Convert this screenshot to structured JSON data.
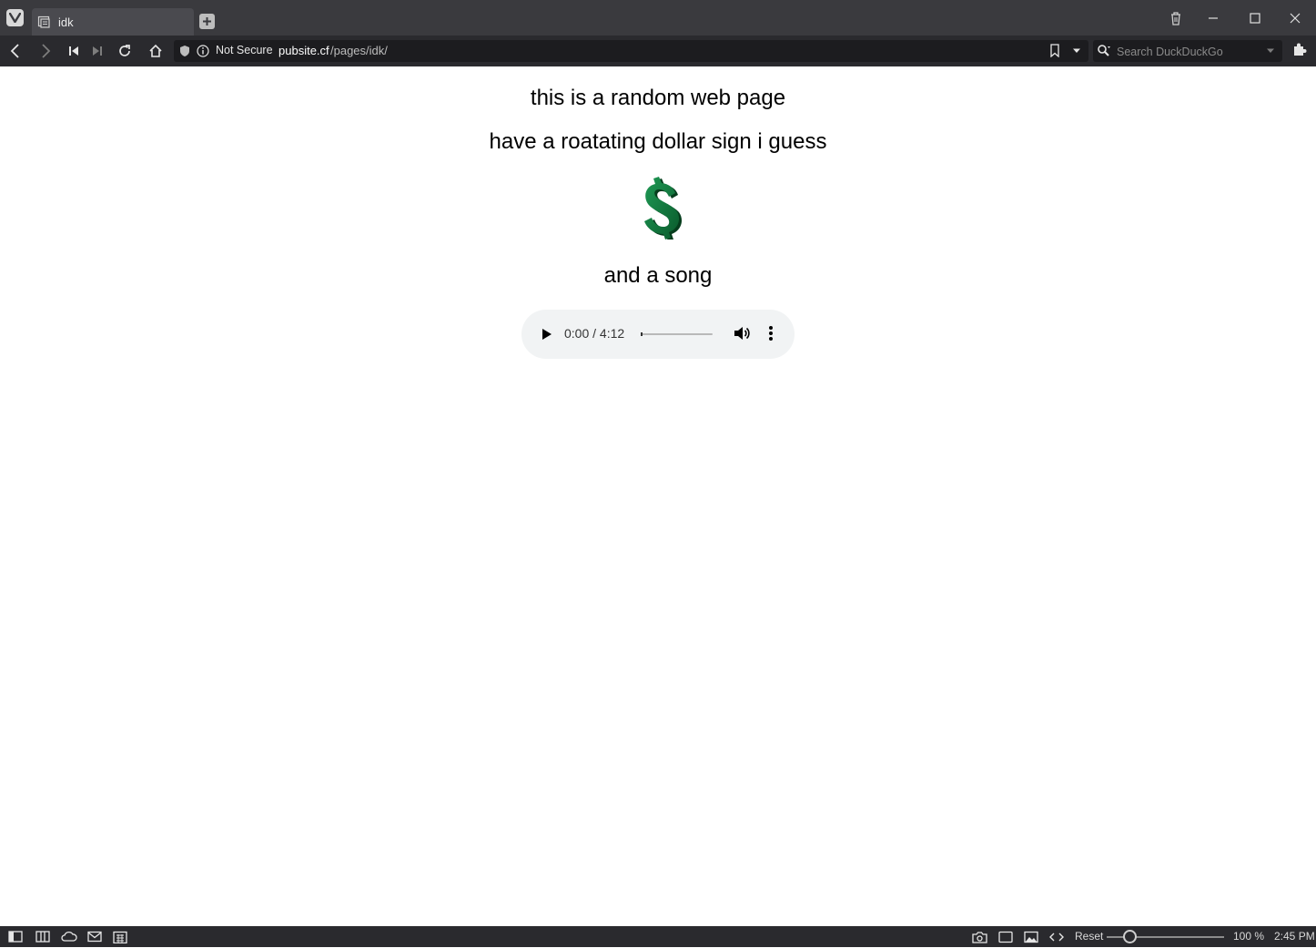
{
  "browser": {
    "tab": {
      "title": "idk"
    },
    "address_bar": {
      "security_label": "Not Secure",
      "host": "pubsite.cf",
      "path": "/pages/idk/"
    },
    "search": {
      "placeholder": "Search DuckDuckGo"
    }
  },
  "page": {
    "line1": "this is a random web page",
    "line2": "have a roatating dollar sign i guess",
    "line3": "and a song",
    "audio": {
      "time": "0:00 / 4:12",
      "progress_fraction": 0
    }
  },
  "statusbar": {
    "reset_label": "Reset",
    "zoom_label": "100 %",
    "clock": "2:45 PM",
    "zoom_fraction": 0.2
  },
  "colors": {
    "chrome_dark": "#2a2a2e",
    "tabbar": "#3a3a3e",
    "dollar_green": "#0e7a3e",
    "audio_bg": "#f1f3f4"
  },
  "icons": {
    "app_menu": "vivaldi-logo-icon",
    "tab_favicon": "page-icon",
    "new_tab": "plus-icon",
    "trash": "trash-icon",
    "minimize": "minimize-icon",
    "maximize": "maximize-icon",
    "close": "close-icon",
    "back": "chevron-left-icon",
    "forward": "chevron-right-icon",
    "rewind": "rewind-icon",
    "fast_forward": "fast-forward-icon",
    "reload": "reload-icon",
    "home": "home-icon",
    "shield": "shield-icon",
    "info": "info-icon",
    "bookmark": "bookmark-icon",
    "dropdown": "caret-down-icon",
    "search": "search-icon",
    "extensions": "puzzle-icon",
    "panel": "panel-toggle-icon",
    "tiling": "tab-tiling-icon",
    "sync": "cloud-icon",
    "mail": "mail-icon",
    "calendar": "calendar-icon",
    "capture": "camera-icon",
    "window": "window-icon",
    "images": "image-icon",
    "code": "code-icon"
  }
}
